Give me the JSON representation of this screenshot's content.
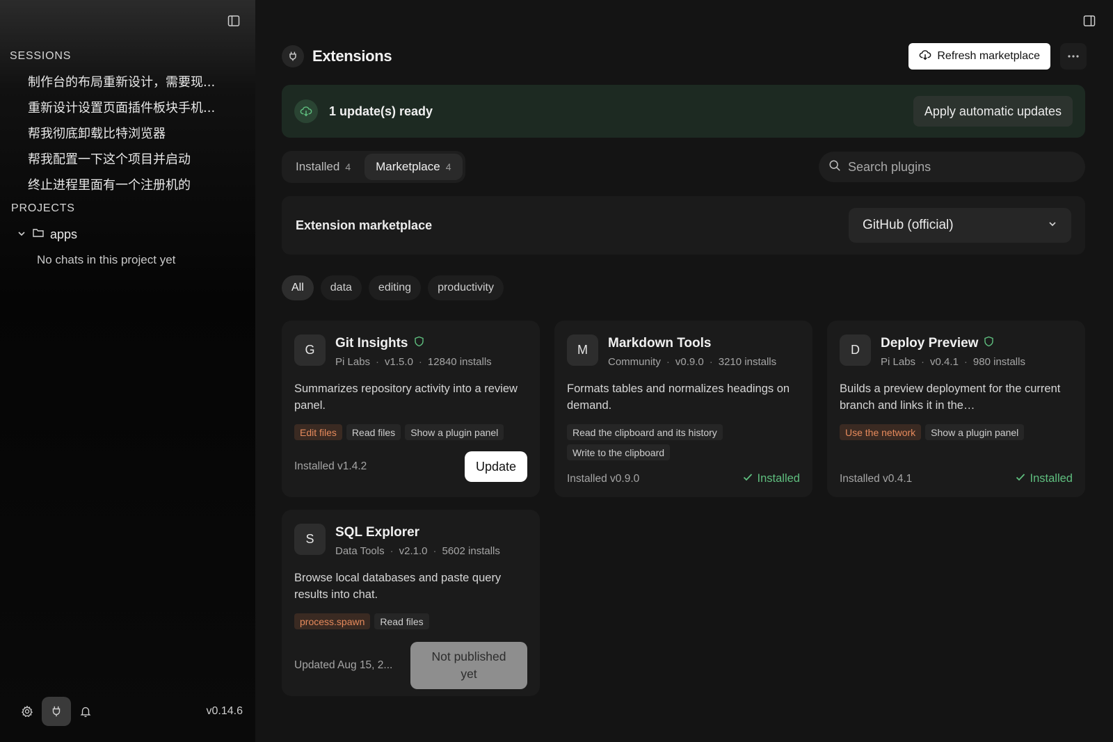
{
  "sidebar": {
    "sessions_label": "SESSIONS",
    "sessions": [
      "制作台的布局重新设计，需要现...",
      "重新设计设置页面插件板块手机...",
      "帮我彻底卸载比特浏览器",
      "帮我配置一下这个项目并启动",
      "终止进程里面有一个注册机的"
    ],
    "projects_label": "PROJECTS",
    "project": {
      "name": "apps",
      "empty_note": "No chats in this project yet"
    },
    "version": "v0.14.6"
  },
  "header": {
    "title": "Extensions",
    "refresh_label": "Refresh marketplace"
  },
  "banner": {
    "text": "1 update(s) ready",
    "apply_label": "Apply automatic updates",
    "color": "#1d2a22"
  },
  "tabs": [
    {
      "label": "Installed",
      "count": "4"
    },
    {
      "label": "Marketplace",
      "count": "4"
    }
  ],
  "search": {
    "placeholder": "Search plugins"
  },
  "marketplace": {
    "title": "Extension marketplace",
    "source_selected": "GitHub (official)"
  },
  "filters": [
    "All",
    "data",
    "editing",
    "productivity"
  ],
  "accent_green": "#5fbf7f",
  "warn_color": "#e68a5c",
  "plugins": [
    {
      "initial": "G",
      "name": "Git Insights",
      "verified": true,
      "author": "Pi Labs",
      "version": "v1.5.0",
      "installs": "12840 installs",
      "description": "Summarizes repository activity into a review panel.",
      "permissions": [
        {
          "label": "Edit files",
          "warn": true
        },
        {
          "label": "Read files",
          "warn": false
        },
        {
          "label": "Show a plugin panel",
          "warn": false
        }
      ],
      "footer_text": "Installed v1.4.2",
      "action": "Update"
    },
    {
      "initial": "M",
      "name": "Markdown Tools",
      "verified": false,
      "author": "Community",
      "version": "v0.9.0",
      "installs": "3210 installs",
      "description": "Formats tables and normalizes headings on demand.",
      "permissions": [
        {
          "label": "Read the clipboard and its history",
          "warn": false
        },
        {
          "label": "Write to the clipboard",
          "warn": false
        }
      ],
      "footer_text": "Installed v0.9.0",
      "action": "Installed"
    },
    {
      "initial": "D",
      "name": "Deploy Preview",
      "verified": true,
      "author": "Pi Labs",
      "version": "v0.4.1",
      "installs": "980 installs",
      "description": "Builds a preview deployment for the current branch and links it in the…",
      "permissions": [
        {
          "label": "Use the network",
          "warn": true
        },
        {
          "label": "Show a plugin panel",
          "warn": false
        }
      ],
      "footer_text": "Installed v0.4.1",
      "action": "Installed"
    },
    {
      "initial": "S",
      "name": "SQL Explorer",
      "verified": false,
      "author": "Data Tools",
      "version": "v2.1.0",
      "installs": "5602 installs",
      "description": "Browse local databases and paste query results into chat.",
      "permissions": [
        {
          "label": "process.spawn",
          "warn": true
        },
        {
          "label": "Read files",
          "warn": false
        }
      ],
      "footer_text": "Updated Aug 15, 2...",
      "action": "Not published yet"
    }
  ]
}
